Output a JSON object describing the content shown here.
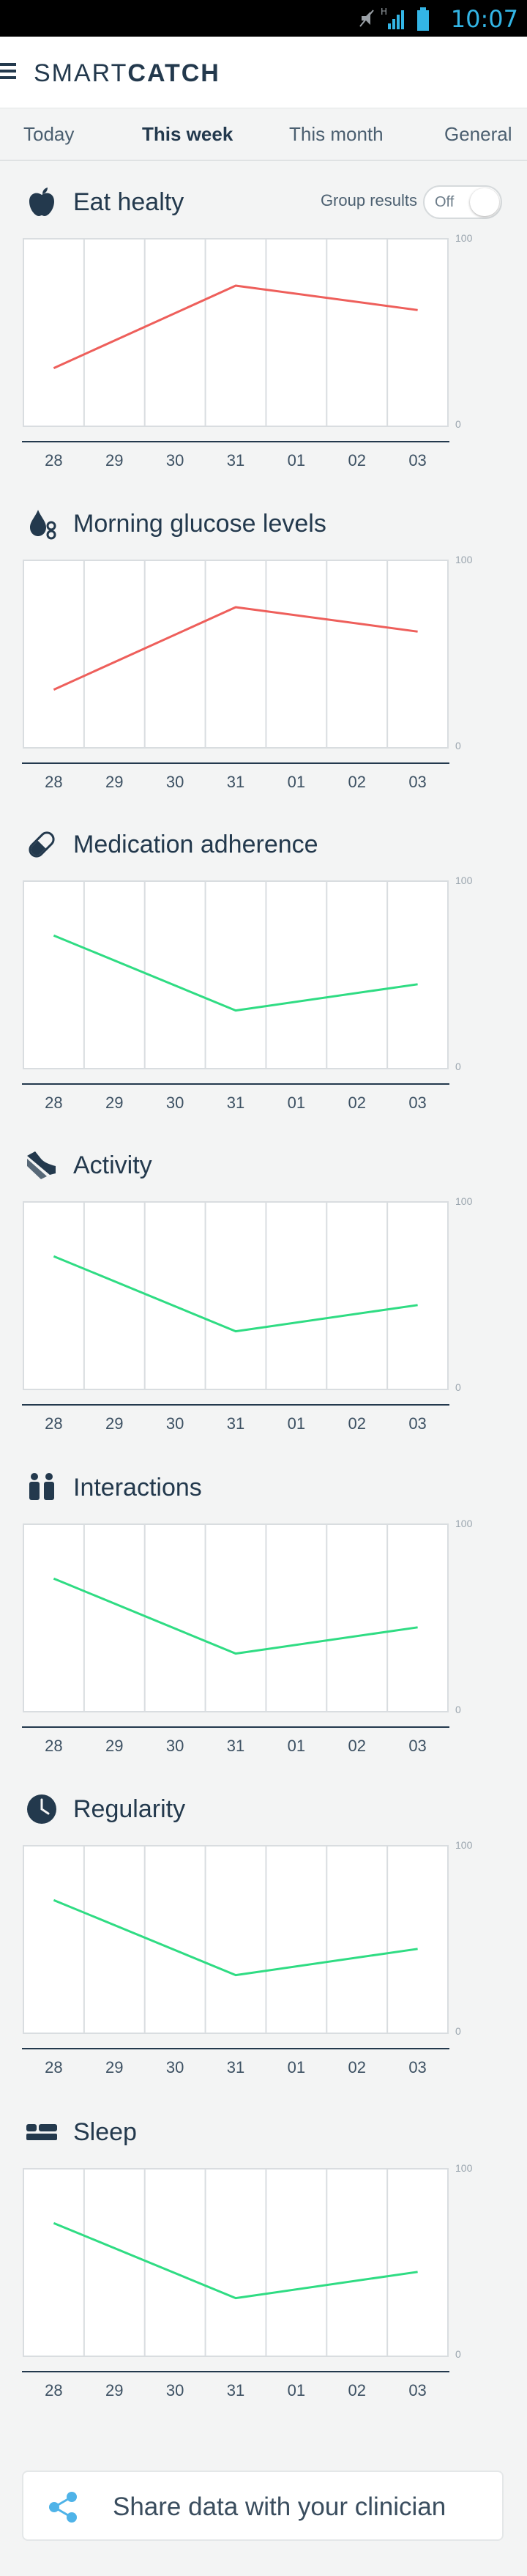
{
  "status": {
    "time": "10:07",
    "network": "H"
  },
  "app": {
    "logo_light": "SMART",
    "logo_bold": "CATCH"
  },
  "tabs": [
    {
      "label": "Today",
      "active": false
    },
    {
      "label": "This week",
      "active": true
    },
    {
      "label": "This month",
      "active": false
    },
    {
      "label": "General",
      "active": false
    }
  ],
  "group_results": {
    "label": "Group results",
    "state": "Off"
  },
  "sections": [
    {
      "title": "Eat healty",
      "icon": "apple-icon"
    },
    {
      "title": "Morning glucose levels",
      "icon": "drop-icon"
    },
    {
      "title": "Medication adherence",
      "icon": "pill-icon"
    },
    {
      "title": "Activity",
      "icon": "shoe-icon"
    },
    {
      "title": "Interactions",
      "icon": "people-icon"
    },
    {
      "title": "Regularity",
      "icon": "clock-icon"
    },
    {
      "title": "Sleep",
      "icon": "bed-icon"
    }
  ],
  "share": {
    "label": "Share data with your clinician",
    "icon": "share-icon"
  },
  "colors": {
    "red_series": "#ee5f5b",
    "green_series": "#2fdc83",
    "navy": "#23394d"
  },
  "chart_data": [
    {
      "type": "line",
      "title": "Eat healty",
      "categories": [
        "28",
        "29",
        "30",
        "31",
        "01",
        "02",
        "03"
      ],
      "x": [
        "28",
        "31",
        "03"
      ],
      "values": [
        31,
        75,
        62
      ],
      "ylim": [
        0,
        100
      ],
      "yticks": [
        "100",
        "0"
      ],
      "color": "#ee5f5b",
      "grid": true
    },
    {
      "type": "line",
      "title": "Morning glucose levels",
      "categories": [
        "28",
        "29",
        "30",
        "31",
        "01",
        "02",
        "03"
      ],
      "x": [
        "28",
        "31",
        "03"
      ],
      "values": [
        31,
        75,
        62
      ],
      "ylim": [
        0,
        100
      ],
      "yticks": [
        "100",
        "0"
      ],
      "color": "#ee5f5b",
      "grid": true
    },
    {
      "type": "line",
      "title": "Medication adherence",
      "categories": [
        "28",
        "29",
        "30",
        "31",
        "01",
        "02",
        "03"
      ],
      "x": [
        "28",
        "31",
        "03"
      ],
      "values": [
        71,
        31,
        45
      ],
      "ylim": [
        0,
        100
      ],
      "yticks": [
        "100",
        "0"
      ],
      "color": "#2fdc83",
      "grid": true
    },
    {
      "type": "line",
      "title": "Activity",
      "categories": [
        "28",
        "29",
        "30",
        "31",
        "01",
        "02",
        "03"
      ],
      "x": [
        "28",
        "31",
        "03"
      ],
      "values": [
        71,
        31,
        45
      ],
      "ylim": [
        0,
        100
      ],
      "yticks": [
        "100",
        "0"
      ],
      "color": "#2fdc83",
      "grid": true
    },
    {
      "type": "line",
      "title": "Interactions",
      "categories": [
        "28",
        "29",
        "30",
        "31",
        "01",
        "02",
        "03"
      ],
      "x": [
        "28",
        "31",
        "03"
      ],
      "values": [
        71,
        31,
        45
      ],
      "ylim": [
        0,
        100
      ],
      "yticks": [
        "100",
        "0"
      ],
      "color": "#2fdc83",
      "grid": true
    },
    {
      "type": "line",
      "title": "Regularity",
      "categories": [
        "28",
        "29",
        "30",
        "31",
        "01",
        "02",
        "03"
      ],
      "x": [
        "28",
        "31",
        "03"
      ],
      "values": [
        71,
        31,
        45
      ],
      "ylim": [
        0,
        100
      ],
      "yticks": [
        "100",
        "0"
      ],
      "color": "#2fdc83",
      "grid": true
    },
    {
      "type": "line",
      "title": "Sleep",
      "categories": [
        "28",
        "29",
        "30",
        "31",
        "01",
        "02",
        "03"
      ],
      "x": [
        "28",
        "31",
        "03"
      ],
      "values": [
        71,
        31,
        45
      ],
      "ylim": [
        0,
        100
      ],
      "yticks": [
        "100",
        "0"
      ],
      "color": "#2fdc83",
      "grid": true
    }
  ]
}
